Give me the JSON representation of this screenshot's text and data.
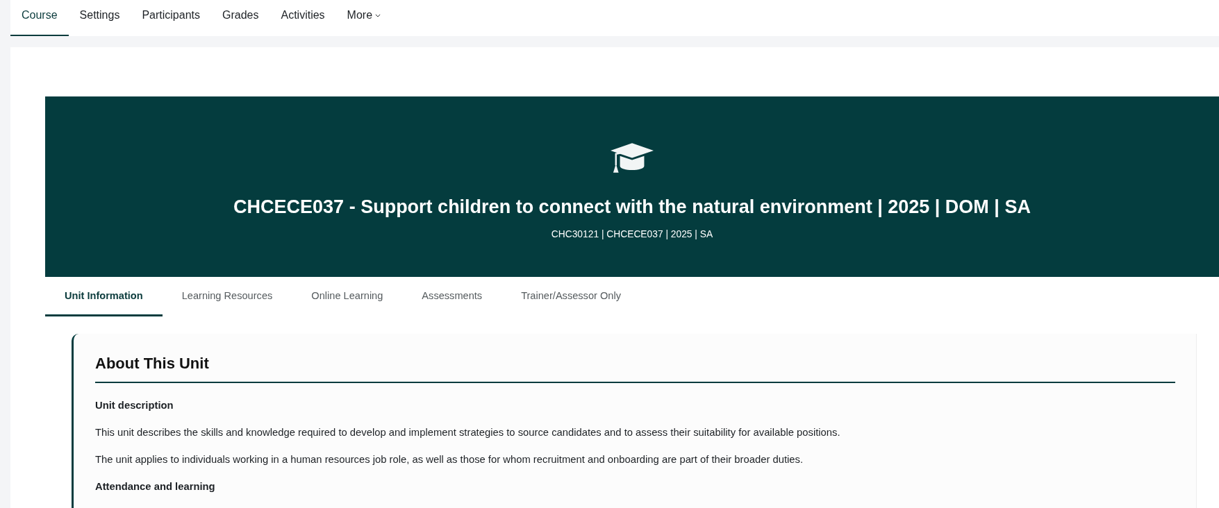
{
  "nav": {
    "items": [
      {
        "label": "Course",
        "selected": true,
        "kind": "link"
      },
      {
        "label": "Settings",
        "selected": false,
        "kind": "link"
      },
      {
        "label": "Participants",
        "selected": false,
        "kind": "link"
      },
      {
        "label": "Grades",
        "selected": false,
        "kind": "link"
      },
      {
        "label": "Activities",
        "selected": false,
        "kind": "link"
      },
      {
        "label": "More",
        "selected": false,
        "kind": "dropdown"
      }
    ]
  },
  "banner": {
    "title": "CHCECE037 - Support children to connect with the natural environment | 2025 | DOM | SA",
    "subtitle": "CHC30121 | CHCECE037 | 2025 | SA"
  },
  "tabs": [
    {
      "label": "Unit Information",
      "selected": true
    },
    {
      "label": "Learning Resources",
      "selected": false
    },
    {
      "label": "Online Learning",
      "selected": false
    },
    {
      "label": "Assessments",
      "selected": false
    },
    {
      "label": "Trainer/Assessor Only",
      "selected": false
    }
  ],
  "section": {
    "heading": "About This Unit",
    "blocks": [
      {
        "kind": "subheading",
        "text": "Unit description"
      },
      {
        "kind": "paragraph",
        "text": "This unit describes the skills and knowledge required to develop and implement strategies to source candidates and to assess their suitability for available positions."
      },
      {
        "kind": "paragraph",
        "text": "The unit applies to individuals working in a human resources job role, as well as those for whom recruitment and onboarding are part of their broader duties."
      },
      {
        "kind": "subheading",
        "text": "Attendance and learning"
      }
    ]
  }
}
